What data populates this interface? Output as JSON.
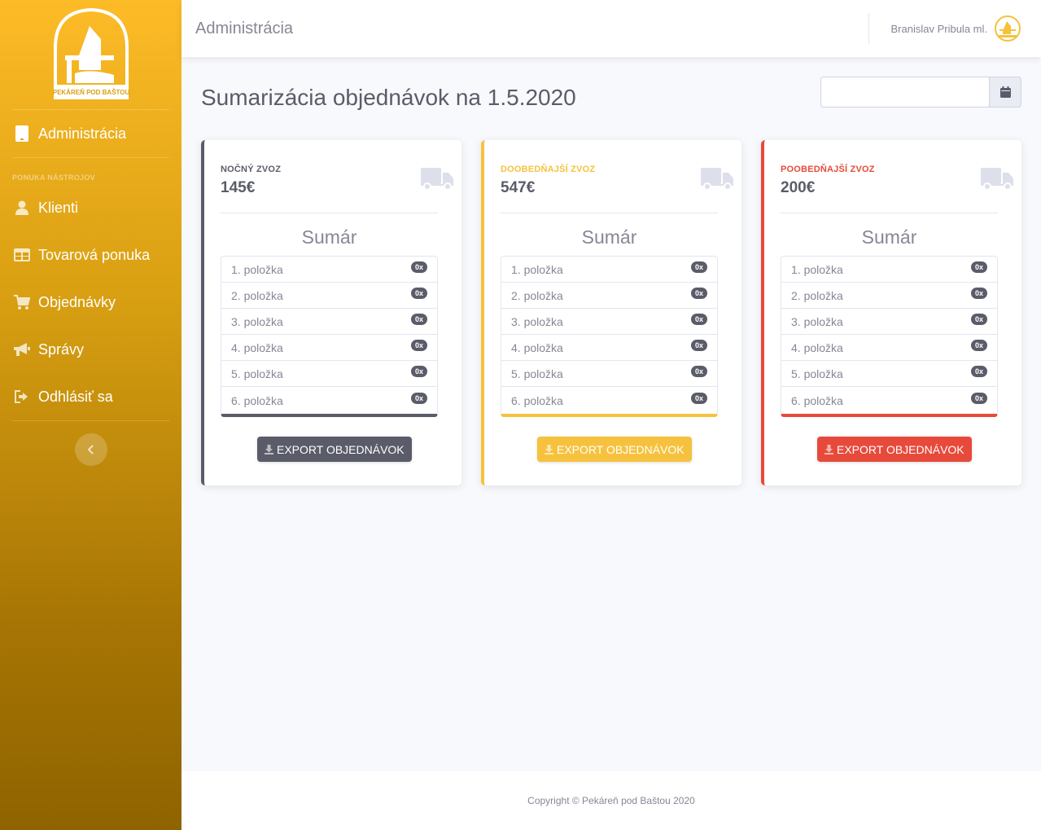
{
  "colors": {
    "primary": "#5a5c69",
    "warning": "#f6c23e",
    "danger": "#e74a3b",
    "sidebar_top": "#fdbb27",
    "sidebar_bottom": "#8f6300"
  },
  "brand": {
    "logo_text": "PEKÁREŇ POD BAŠTOU"
  },
  "sidebar": {
    "dashboard": {
      "label": "Administrácia",
      "icon": "tablet-icon"
    },
    "heading": "PONUKA NÁSTROJOV",
    "items": [
      {
        "label": "Klienti",
        "icon": "user-icon"
      },
      {
        "label": "Tovarová ponuka",
        "icon": "table-icon"
      },
      {
        "label": "Objednávky",
        "icon": "cart-icon"
      },
      {
        "label": "Správy",
        "icon": "bullhorn-icon"
      },
      {
        "label": "Odhlásiť sa",
        "icon": "sign-out-icon"
      }
    ],
    "toggle_icon": "chevron-left-icon"
  },
  "topbar": {
    "title": "Administrácia",
    "user_name": "Branislav Pribula ml."
  },
  "main": {
    "title": "Sumarizácia objednávok na 1.5.2020",
    "date_value": ""
  },
  "cards": [
    {
      "label": "Nočný zvoz",
      "value": "145€",
      "sum_title": "Sumár",
      "items": [
        {
          "name": "1. položka",
          "count": "0x"
        },
        {
          "name": "2. položka",
          "count": "0x"
        },
        {
          "name": "3. položka",
          "count": "0x"
        },
        {
          "name": "4. položka",
          "count": "0x"
        },
        {
          "name": "5. položka",
          "count": "0x"
        },
        {
          "name": "6. položka",
          "count": "0x"
        }
      ],
      "button": "EXPORT OBJEDNÁVOK"
    },
    {
      "label": "Doobedňajší zvoz",
      "value": "547€",
      "sum_title": "Sumár",
      "items": [
        {
          "name": "1. položka",
          "count": "0x"
        },
        {
          "name": "2. položka",
          "count": "0x"
        },
        {
          "name": "3. položka",
          "count": "0x"
        },
        {
          "name": "4. položka",
          "count": "0x"
        },
        {
          "name": "5. položka",
          "count": "0x"
        },
        {
          "name": "6. položka",
          "count": "0x"
        }
      ],
      "button": "EXPORT OBJEDNÁVOK"
    },
    {
      "label": "Poobedňajší zvoz",
      "value": "200€",
      "sum_title": "Sumár",
      "items": [
        {
          "name": "1. položka",
          "count": "0x"
        },
        {
          "name": "2. položka",
          "count": "0x"
        },
        {
          "name": "3. položka",
          "count": "0x"
        },
        {
          "name": "4. položka",
          "count": "0x"
        },
        {
          "name": "5. položka",
          "count": "0x"
        },
        {
          "name": "6. položka",
          "count": "0x"
        }
      ],
      "button": "EXPORT OBJEDNÁVOK"
    }
  ],
  "footer": {
    "copyright": "Copyright © Pekáreň pod Baštou 2020"
  }
}
